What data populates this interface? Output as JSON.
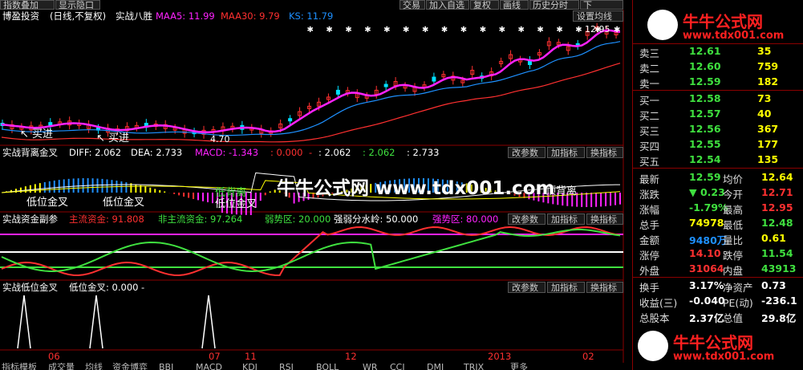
{
  "toolbar_top": {
    "indicator_overlay": "指数叠加",
    "show_hide": "显示隐口",
    "trade": "交易",
    "add_watch": "加入自选",
    "restore": "复权",
    "draw_line": "画线",
    "history": "历史分时",
    "more_chars": "下"
  },
  "main_chart": {
    "stock_name": "博盈投资",
    "period": "(日线,不复权)",
    "indicator": "实战八胜",
    "maa5_label": "MAA5: 11.99",
    "maa30_label": "MAA30: 9.79",
    "ks_label": "KS: 11.79",
    "set_ma_button": "设置均线",
    "price_high": "12.95",
    "price_low": "4.70",
    "buy_signal_1": "↖ 买进",
    "buy_signal_2": "↖ 买进",
    "colors": {
      "maa5": "#ff22ff",
      "maa30": "#ff3030",
      "ks": "#1e90ff",
      "up_candle": "#ff3030",
      "down_candle": "#00e0ff"
    }
  },
  "panel_macd": {
    "title": "实战背离金叉",
    "diff": "DIFF: 2.062",
    "dea": "DEA: 2.733",
    "macd": "MACD: -1.343",
    "v4": ": 0.000",
    "v5": "-",
    "v6": ": 2.062",
    "v7": ": 2.062",
    "v8": ": 2.733",
    "buttons": [
      "改参数",
      "加指标",
      "换指标"
    ],
    "annotations": [
      "低位金叉",
      "低位金叉",
      "低位金叉",
      "低背离",
      "顶背离"
    ]
  },
  "panel_fund": {
    "title": "实战资金副参",
    "main_fund": "主流资金: 91.808",
    "non_main_fund": "非主流资金: 97.264",
    "weak_zone": "弱势区: 20.000",
    "waterline": "强弱分水岭: 50.000",
    "strong_zone": "强势区: 80.000",
    "buttons": [
      "改参数",
      "加指标",
      "换指标"
    ]
  },
  "panel_low": {
    "title": "实战低位金叉",
    "value": "低位金叉: 0.000",
    "dash": "-",
    "buttons": [
      "改参数",
      "加指标",
      "换指标"
    ]
  },
  "x_axis": [
    "06",
    "07",
    "11",
    "12",
    "2013",
    "02"
  ],
  "bottom_tabs": [
    "指标模板",
    "成交量",
    "均线",
    "资金博弈",
    "BBI",
    "MACD",
    "KDJ",
    "RSI",
    "BOLL",
    "WR",
    "CCI",
    "DMI",
    "TRIX",
    "更多"
  ],
  "watermark": {
    "center": "牛牛公式网 www.tdx001.com"
  },
  "logo": {
    "title": "牛牛公式网",
    "url": "www.tdx001.com"
  },
  "order_book": {
    "sell": [
      {
        "label": "卖三",
        "price": "12.61",
        "vol": "35"
      },
      {
        "label": "卖二",
        "price": "12.60",
        "vol": "759"
      },
      {
        "label": "卖一",
        "price": "12.59",
        "vol": "182"
      }
    ],
    "buy": [
      {
        "label": "买一",
        "price": "12.58",
        "vol": "73"
      },
      {
        "label": "买二",
        "price": "12.57",
        "vol": "40"
      },
      {
        "label": "买三",
        "price": "12.56",
        "vol": "367"
      },
      {
        "label": "买四",
        "price": "12.55",
        "vol": "177"
      },
      {
        "label": "买五",
        "price": "12.54",
        "vol": "135"
      }
    ]
  },
  "quote": {
    "latest_k": "最新",
    "latest_v": "12.59",
    "avg_k": "均价",
    "avg_v": "12.64",
    "chg_k": "涨跌",
    "chg_v": "▼ 0.23",
    "open_k": "今开",
    "open_v": "12.71",
    "pct_k": "涨幅",
    "pct_v": "-1.79%",
    "high_k": "最高",
    "high_v": "12.95",
    "vol_k": "总手",
    "vol_v": "74978",
    "low_k": "最低",
    "low_v": "12.48",
    "amt_k": "金额",
    "amt_v": "9480万",
    "ratio_k": "量比",
    "ratio_v": "0.61",
    "lim_up_k": "涨停",
    "lim_up_v": "14.10",
    "lim_dn_k": "跌停",
    "lim_dn_v": "11.54",
    "outer_k": "外盘",
    "outer_v": "31064",
    "inner_k": "内盘",
    "inner_v": "43913",
    "turn_k": "换手",
    "turn_v": "3.17%",
    "nav_k": "净资产",
    "nav_v": "0.73",
    "eps_k": "收益(三)",
    "eps_v": "-0.040",
    "pe_k": "PE(动)",
    "pe_v": "-236.1",
    "shares_k": "总股本",
    "shares_v": "2.37亿",
    "mcap_k": "总值",
    "mcap_v": "29.8亿"
  }
}
